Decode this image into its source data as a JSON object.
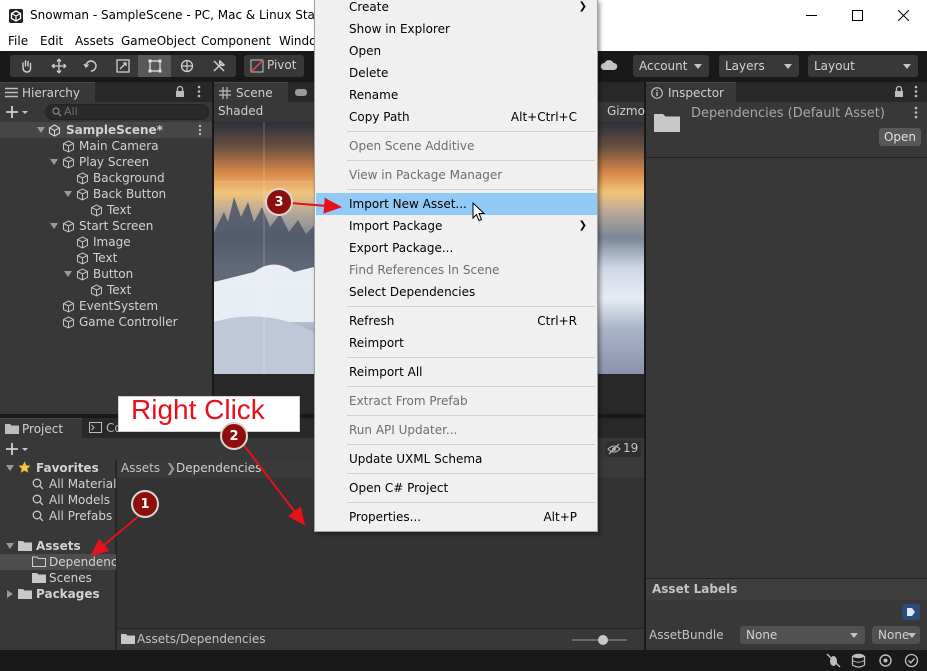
{
  "window": {
    "title": "Snowman - SampleScene - PC, Mac & Linux Standalo",
    "minimize": "—",
    "maximize": "☐",
    "close": "✕"
  },
  "menubar": [
    "File",
    "Edit",
    "Assets",
    "GameObject",
    "Component",
    "Windo"
  ],
  "toolbar": {
    "pivot_label": "Pivot",
    "account_label": "Account",
    "layers_label": "Layers",
    "layout_label": "Layout"
  },
  "hierarchy": {
    "tab_label": "Hierarchy",
    "search_placeholder": "All",
    "scene_name": "SampleScene*",
    "items": [
      {
        "label": "Main Camera"
      },
      {
        "label": "Play Screen"
      },
      {
        "label": "Background"
      },
      {
        "label": "Back Button"
      },
      {
        "label": "Text"
      },
      {
        "label": "Start Screen"
      },
      {
        "label": "Image"
      },
      {
        "label": "Text"
      },
      {
        "label": "Button"
      },
      {
        "label": "Text"
      },
      {
        "label": "EventSystem"
      },
      {
        "label": "Game Controller"
      }
    ]
  },
  "scene": {
    "tab_label": "Scene",
    "shading_mode": "Shaded",
    "gizmos_label": "Gizmo"
  },
  "project": {
    "tab_label": "Project",
    "console_tab_label": "Console",
    "hidden_count": "19",
    "favorites_label": "Favorites",
    "favorites": [
      "All Materials",
      "All Models",
      "All Prefabs"
    ],
    "assets_label": "Assets",
    "asset_folders": [
      "Dependence",
      "Scenes"
    ],
    "packages_label": "Packages",
    "breadcrumb": [
      "Assets",
      "Dependencies"
    ],
    "footer_path": "Assets/Dependencies"
  },
  "inspector": {
    "tab_label": "Inspector",
    "asset_title": "Dependencies (Default Asset)",
    "open_button": "Open",
    "asset_labels_heading": "Asset Labels",
    "assetbundle_label": "AssetBundle",
    "assetbundle_value": "None",
    "variant_value": "None"
  },
  "context_menu": [
    {
      "label": "Create",
      "submenu": true
    },
    {
      "label": "Show in Explorer"
    },
    {
      "label": "Open"
    },
    {
      "label": "Delete"
    },
    {
      "label": "Rename"
    },
    {
      "label": "Copy Path",
      "shortcut": "Alt+Ctrl+C"
    },
    {
      "label": "Open Scene Additive",
      "disabled": true
    },
    {
      "label": "View in Package Manager",
      "disabled": true
    },
    {
      "label": "Import New Asset...",
      "highlighted": true
    },
    {
      "label": "Import Package",
      "submenu": true
    },
    {
      "label": "Export Package..."
    },
    {
      "label": "Find References In Scene",
      "disabled": true
    },
    {
      "label": "Select Dependencies"
    },
    {
      "label": "Refresh",
      "shortcut": "Ctrl+R"
    },
    {
      "label": "Reimport"
    },
    {
      "label": "Reimport All"
    },
    {
      "label": "Extract From Prefab",
      "disabled": true
    },
    {
      "label": "Run API Updater...",
      "disabled": true
    },
    {
      "label": "Update UXML Schema"
    },
    {
      "label": "Open C# Project"
    },
    {
      "label": "Properties...",
      "shortcut": "Alt+P"
    }
  ],
  "annotations": {
    "right_click_text": "Right Click",
    "step1": "1",
    "step2": "2",
    "step3": "3",
    "callout_color": "#e8101a"
  }
}
